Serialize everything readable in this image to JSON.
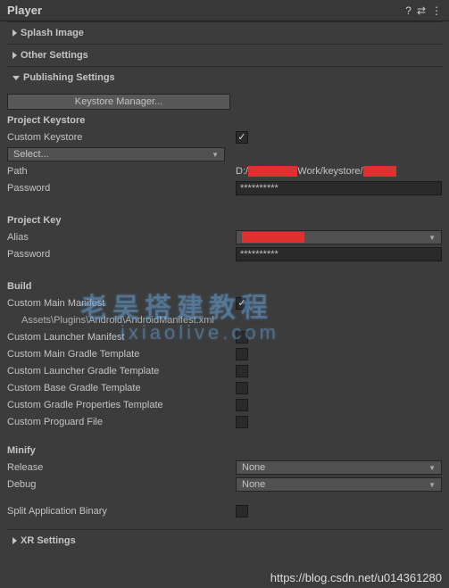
{
  "header": {
    "title": "Player"
  },
  "sections": {
    "splash_image": {
      "title": "Splash Image"
    },
    "other_settings": {
      "title": "Other Settings"
    },
    "publishing_settings": {
      "title": "Publishing Settings",
      "keystore_manager_btn": "Keystore Manager...",
      "project_keystore": {
        "header": "Project Keystore",
        "custom_keystore_label": "Custom Keystore",
        "custom_keystore_checked": true,
        "select_label": "Select...",
        "path_label": "Path",
        "path_value_prefix": "D:/",
        "path_value_mid": "Work/keystore/",
        "password_label": "Password",
        "password_value": "**********"
      },
      "project_key": {
        "header": "Project Key",
        "alias_label": "Alias",
        "alias_value": " ",
        "password_label": "Password",
        "password_value": "**********"
      },
      "build": {
        "header": "Build",
        "custom_main_manifest_label": "Custom Main Manifest",
        "custom_main_manifest_checked": true,
        "manifest_path": "Assets\\Plugins\\Android\\AndroidManifest.xml",
        "custom_launcher_manifest_label": "Custom Launcher Manifest",
        "custom_main_gradle_label": "Custom Main Gradle Template",
        "custom_launcher_gradle_label": "Custom Launcher Gradle Template",
        "custom_base_gradle_label": "Custom Base Gradle Template",
        "custom_gradle_props_label": "Custom Gradle Properties Template",
        "custom_proguard_label": "Custom Proguard File"
      },
      "minify": {
        "header": "Minify",
        "release_label": "Release",
        "release_value": "None",
        "debug_label": "Debug",
        "debug_value": "None"
      },
      "split_binary_label": "Split Application Binary"
    },
    "xr_settings": {
      "title": "XR Settings"
    }
  },
  "watermark": {
    "line1": "老吴搭建教程",
    "line2": "ixiaolive.com"
  },
  "footer_url": "https://blog.csdn.net/u014361280"
}
